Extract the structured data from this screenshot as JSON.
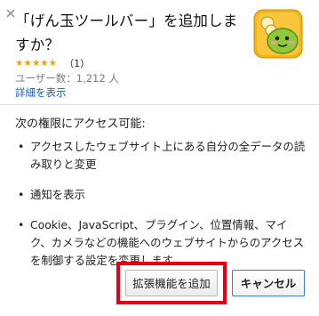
{
  "dialog": {
    "title": "「げん玉ツールバー」を追加しますか？",
    "stars": "★★★★★",
    "rating_count": "（1）",
    "users": "ユーザー数：1,212 人",
    "details_link": "詳細を表示",
    "permissions_heading": "次の権限にアクセス可能:",
    "permissions": [
      "アクセスしたウェブサイト上にある自分の全データの読み取りと変更",
      "通知を表示",
      "Cookie、JavaScript、プラグイン、位置情報、マイク、カメラなどの機能へのウェブサイトからのアクセスを制御する設定を変更します。"
    ],
    "bullet": "•",
    "add_button": "拡張機能を追加",
    "cancel_button": "キャンセル",
    "highlight_color": "#e60012",
    "icon": "genta-extension-icon"
  }
}
